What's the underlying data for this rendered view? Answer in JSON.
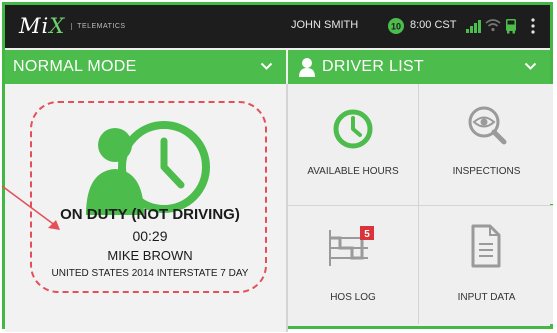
{
  "header": {
    "brand": "MiX",
    "brand_sub": "TELEMATICS",
    "user_name": "JOHN SMITH",
    "notification_count": "10",
    "time": "8:00 CST"
  },
  "mode_bar": {
    "label": "NORMAL MODE"
  },
  "driver_bar": {
    "label": "DRIVER LIST"
  },
  "status_card": {
    "status": "ON DUTY (NOT DRIVING)",
    "duration": "00:29",
    "driver": "MIKE BROWN",
    "ruleset": "UNITED STATES 2014 INTERSTATE 7 DAY"
  },
  "tiles": [
    {
      "label": "AVAILABLE HOURS",
      "icon": "clock-icon"
    },
    {
      "label": "INSPECTIONS",
      "icon": "eye-magnifier-icon"
    },
    {
      "label": "HOS LOG",
      "icon": "log-chart-icon",
      "badge": "5"
    },
    {
      "label": "INPUT DATA",
      "icon": "document-icon"
    }
  ],
  "colors": {
    "accent": "#4cbc4c",
    "topbar": "#1d1d1d",
    "highlight": "#e4505a",
    "badge": "#d9343a"
  }
}
